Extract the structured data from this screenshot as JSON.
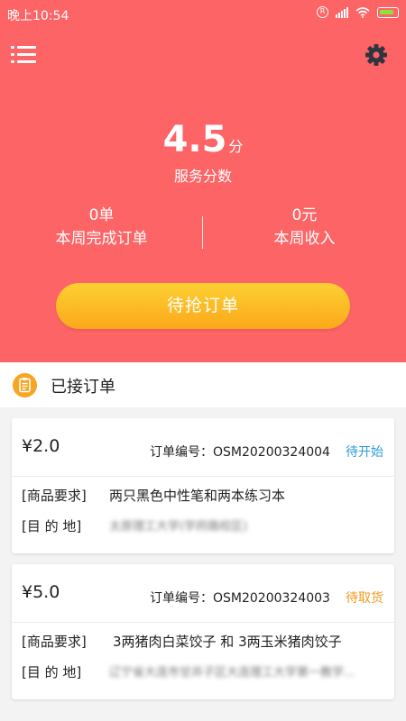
{
  "status_bar": {
    "time": "晚上10:54",
    "icons": [
      "r-icon",
      "signal-icon",
      "wifi-icon",
      "battery-icon"
    ],
    "r_glyph": "R"
  },
  "toolbar": {
    "menu_icon": "list-menu-icon",
    "settings_icon": "gear-icon"
  },
  "score": {
    "value": "4.5",
    "unit": "分",
    "label": "服务分数"
  },
  "stats": [
    {
      "value": "0单",
      "label": "本周完成订单"
    },
    {
      "value": "0元",
      "label": "本周收入"
    }
  ],
  "grab_button": {
    "label": "待抢订单"
  },
  "section": {
    "title": "已接订单",
    "icon": "clipboard-icon"
  },
  "orders": [
    {
      "price": "¥2.0",
      "order_no": "订单编号：OSM20200324004",
      "status": "待开始",
      "status_color": "#2d9ad6",
      "requirement_label": "[商品要求]",
      "requirement": "两只黑色中性笔和两本练习本",
      "destination_label": "[目  的  地]",
      "destination": "太原理工大学(学府路校区)"
    },
    {
      "price": "¥5.0",
      "order_no": "订单编号：OSM20200324003",
      "status": "待取货",
      "status_color": "#f09a1a",
      "requirement_label": "[商品要求]",
      "requirement": "3两猪肉白菜饺子 和 3两玉米猪肉饺子",
      "destination_label": "[目  的  地]",
      "destination": "辽宁省大连市甘井子区大连理工大学第一教学..."
    }
  ],
  "colors": {
    "header_bg": "#fd6466",
    "button_orange": "#fba81a",
    "page_bg": "#f3f3f3"
  }
}
